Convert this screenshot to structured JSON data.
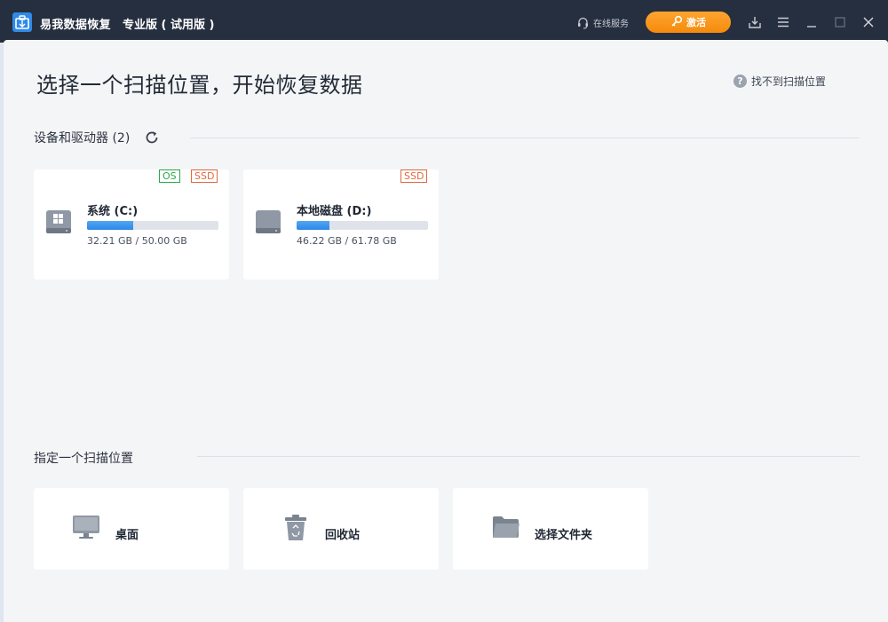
{
  "titlebar": {
    "app_name": "易我数据恢复",
    "edition": "专业版 ( 试用版 )",
    "online_service": "在线服务",
    "activate_label": "激活"
  },
  "header": {
    "title": "选择一个扫描位置，开始恢复数据",
    "help_link": "找不到扫描位置",
    "help_icon": "?"
  },
  "devices": {
    "heading": "设备和驱动器 (2)",
    "drives": [
      {
        "name": "系统 (C:)",
        "size_text": "32.21 GB / 50.00 GB",
        "used_fraction": 0.3508,
        "badges": [
          "OS",
          "SSD"
        ],
        "icon": "windows-drive-icon"
      },
      {
        "name": "本地磁盘 (D:)",
        "size_text": "46.22 GB / 61.78 GB",
        "used_fraction": 0.2503,
        "badges": [
          "SSD"
        ],
        "icon": "hard-drive-icon"
      }
    ]
  },
  "locations": {
    "heading": "指定一个扫描位置",
    "items": [
      {
        "label": "桌面",
        "icon": "desktop-icon"
      },
      {
        "label": "回收站",
        "icon": "recycle-bin-icon"
      },
      {
        "label": "选择文件夹",
        "icon": "folder-icon"
      }
    ]
  },
  "colors": {
    "titlebar_bg": "#262f3f",
    "accent_orange": "#f58a0c",
    "progress_blue": "#2d87e6",
    "badge_os": "#2aa84a",
    "badge_ssd": "#e0693d"
  }
}
